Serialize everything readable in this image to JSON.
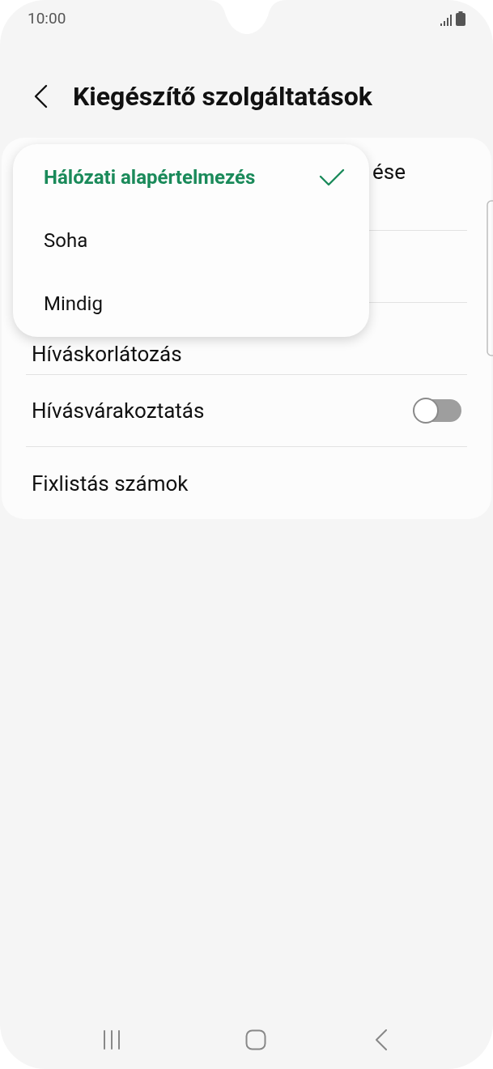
{
  "status_bar": {
    "time": "10:00"
  },
  "header": {
    "title": "Kiegészítő szolgáltatások"
  },
  "settings": [
    {
      "kind": "text",
      "label": "ése"
    },
    {
      "kind": "hidden"
    },
    {
      "kind": "text",
      "label": "Híváskorlátozás"
    },
    {
      "kind": "switch",
      "label": "Hívásvárakoztatás",
      "on": false
    },
    {
      "kind": "text",
      "label": "Fixlistás számok"
    }
  ],
  "popup_menu": {
    "items": [
      {
        "label": "Hálózati alapértelmezés",
        "selected": true
      },
      {
        "label": "Soha",
        "selected": false
      },
      {
        "label": "Mindig",
        "selected": false
      }
    ]
  }
}
